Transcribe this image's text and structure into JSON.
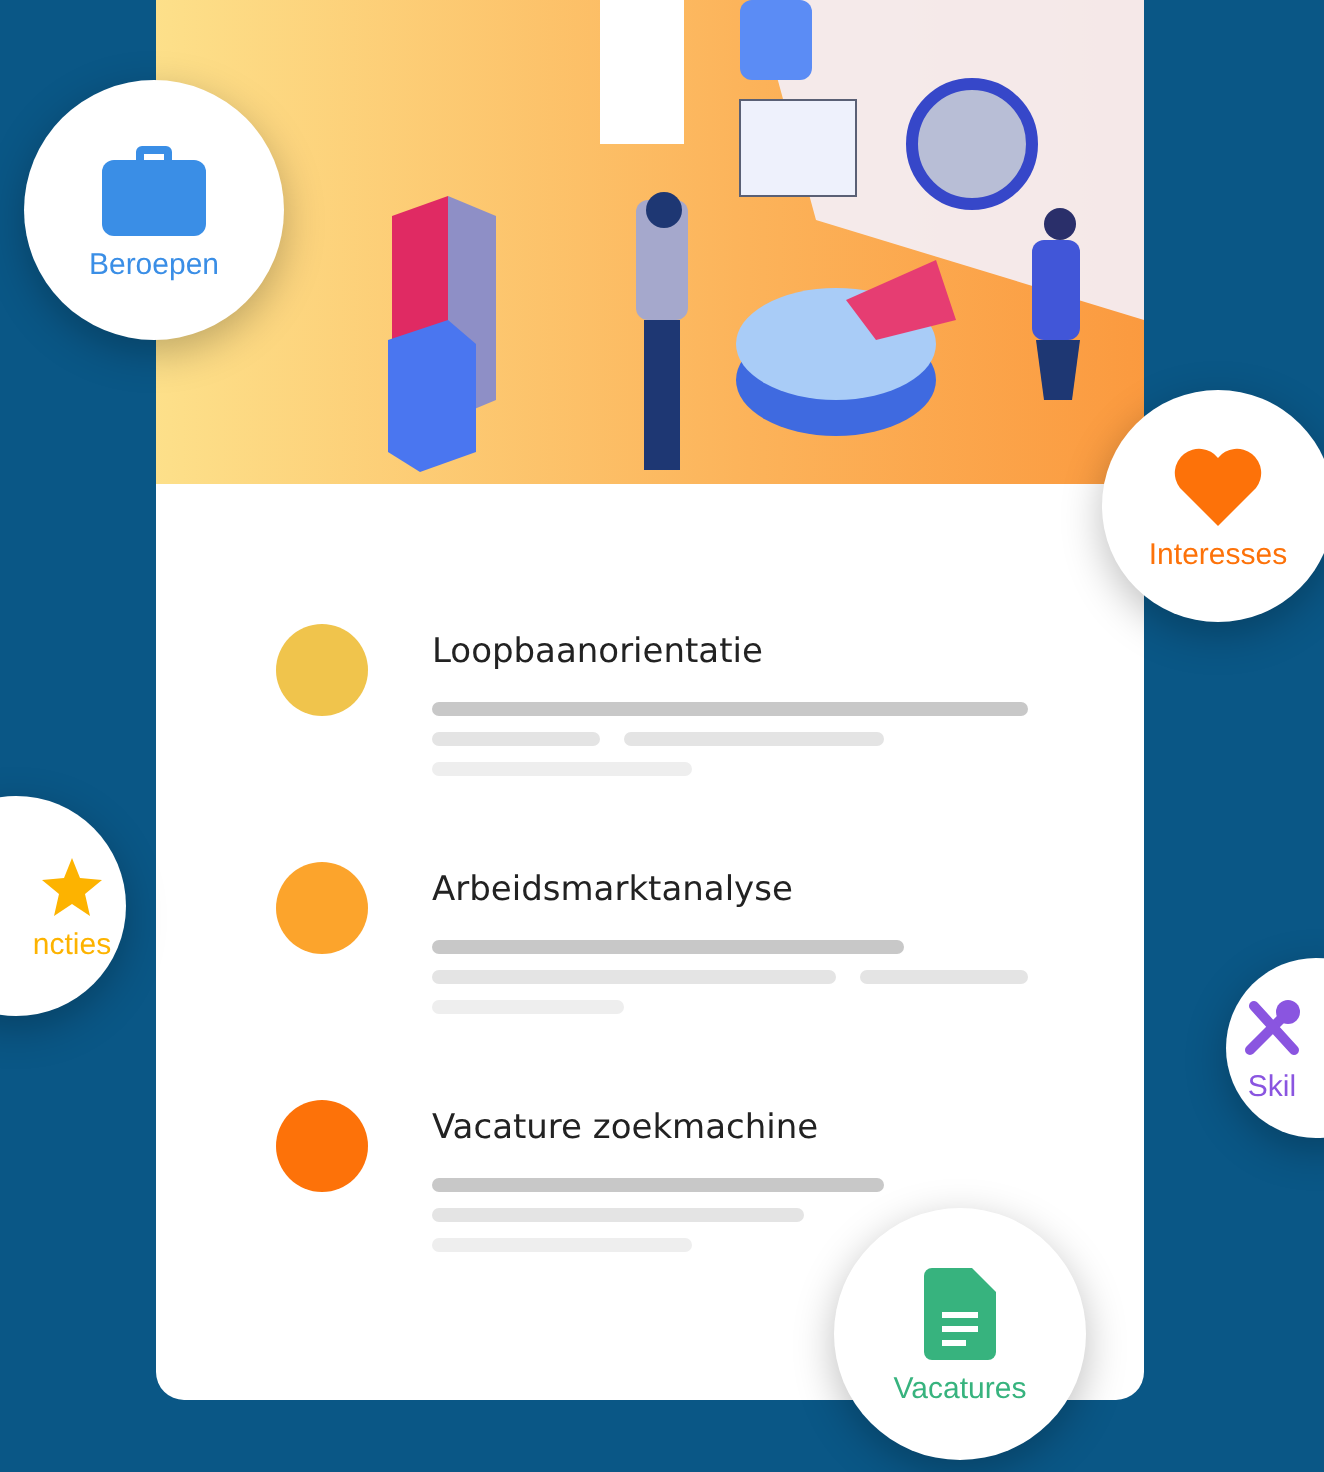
{
  "items": [
    {
      "title": "Loopbaanorientatie",
      "color": "#f0c44c"
    },
    {
      "title": "Arbeidsmarktanalyse",
      "color": "#fca42c"
    },
    {
      "title": "Vacature zoekmachine",
      "color": "#fd7209"
    }
  ],
  "badges": [
    {
      "label": "Beroepen",
      "color": "#3a8ee6"
    },
    {
      "label": "Interesses",
      "color": "#fd7209"
    },
    {
      "label": "ncties",
      "color": "#fdb300"
    },
    {
      "label": "Skil",
      "color": "#8a55e0"
    },
    {
      "label": "Vacatures",
      "color": "#37b37e"
    }
  ]
}
